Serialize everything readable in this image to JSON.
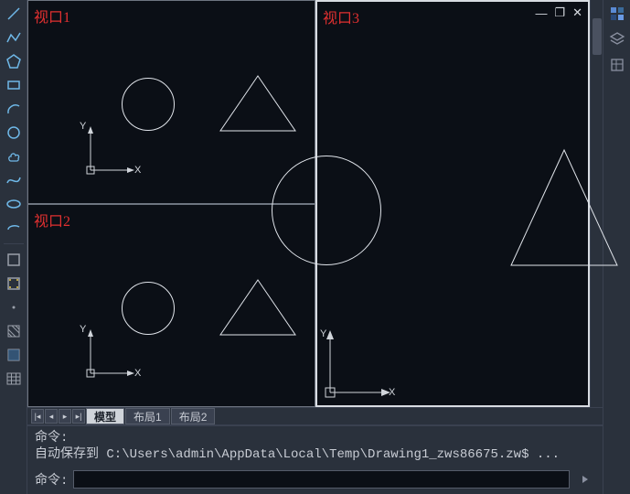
{
  "toolbar_left": {
    "items": [
      {
        "name": "line-icon"
      },
      {
        "name": "polyline-icon"
      },
      {
        "name": "polygon-icon"
      },
      {
        "name": "rectangle-icon"
      },
      {
        "name": "arc-icon"
      },
      {
        "name": "circle-tool-icon"
      },
      {
        "name": "revcloud-icon"
      },
      {
        "name": "spline-icon"
      },
      {
        "name": "ellipse-icon"
      },
      {
        "name": "ellipse-arc-icon"
      },
      {
        "name": "rect-outline-icon"
      },
      {
        "name": "rect-dots-icon"
      },
      {
        "name": "point-icon"
      },
      {
        "name": "hatch-icon"
      },
      {
        "name": "gradient-icon"
      },
      {
        "name": "table-icon"
      }
    ]
  },
  "toolbar_right": {
    "items": [
      {
        "name": "palette-icon"
      },
      {
        "name": "layers-icon"
      },
      {
        "name": "properties-icon"
      }
    ]
  },
  "viewports": {
    "vp1": {
      "label": "视口1"
    },
    "vp2": {
      "label": "视口2"
    },
    "vp3": {
      "label": "视口3"
    }
  },
  "ucs": {
    "x_label": "X",
    "y_label": "Y"
  },
  "window_controls": {
    "minimize": "—",
    "restore": "❐",
    "close": "✕"
  },
  "tabs": {
    "nav": {
      "first": "|◂",
      "prev": "◂",
      "next": "▸",
      "last": "▸|"
    },
    "items": [
      {
        "label": "模型",
        "active": true
      },
      {
        "label": "布局1",
        "active": false
      },
      {
        "label": "布局2",
        "active": false
      }
    ]
  },
  "command": {
    "history_line1": "命令:",
    "history_line2": "自动保存到 C:\\Users\\admin\\AppData\\Local\\Temp\\Drawing1_zws86675.zw$ ...",
    "prompt": "命令:",
    "input_value": ""
  },
  "colors": {
    "accent_red": "#e03030",
    "stroke": "#e0e4ea",
    "bg_dark": "#0b0f16",
    "panel": "#2a313c"
  }
}
